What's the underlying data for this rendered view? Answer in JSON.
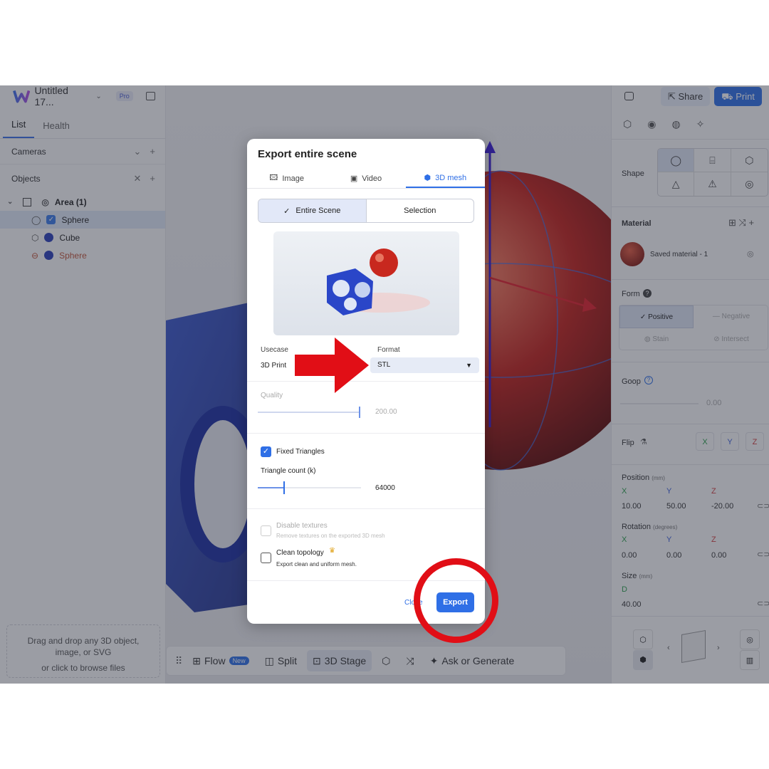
{
  "app": {
    "title": "Untitled 17...",
    "plan_badge": "Pro"
  },
  "left": {
    "tabs": [
      "List",
      "Health"
    ],
    "cameras_label": "Cameras",
    "objects_label": "Objects",
    "tree": [
      {
        "label": "Area (1)"
      },
      {
        "label": "Sphere"
      },
      {
        "label": "Cube"
      },
      {
        "label": "Sphere"
      }
    ],
    "drop_text_1": "Drag and drop any 3D object,",
    "drop_text_2": "image, or SVG",
    "drop_text_3_prefix": "or ",
    "drop_text_3_link": "click to browse files"
  },
  "right": {
    "share_label": "Share",
    "print_label": "Print",
    "shape_label": "Shape",
    "material_label": "Material",
    "material_name": "Saved material - 1",
    "form_label": "Form",
    "form_options": [
      "Positive",
      "Negative",
      "Stain",
      "Intersect"
    ],
    "goop_label": "Goop",
    "goop_value": "0.00",
    "flip_label": "Flip",
    "flip_axes": [
      "X",
      "Y",
      "Z"
    ],
    "position_label": "Position",
    "position_unit": "(mm)",
    "position": {
      "x": "10.00",
      "y": "50.00",
      "z": "-20.00"
    },
    "rotation_label": "Rotation",
    "rotation_unit": "(degrees)",
    "rotation": {
      "x": "0.00",
      "y": "0.00",
      "z": "0.00"
    },
    "size_label": "Size",
    "size_unit": "(mm)",
    "size_axis": "D",
    "size_value": "40.00",
    "axis_x": "X",
    "axis_y": "Y",
    "axis_z": "Z"
  },
  "toolbar": {
    "flow_label": "Flow",
    "new_badge": "New",
    "split_label": "Split",
    "stage_label": "3D Stage",
    "ask_label": "Ask or Generate"
  },
  "dialog": {
    "title": "Export entire scene",
    "tabs": [
      "Image",
      "Video",
      "3D mesh"
    ],
    "scope_options": [
      "Entire Scene",
      "Selection"
    ],
    "usecase_label": "Usecase",
    "usecase_value": "3D Print",
    "format_label": "Format",
    "format_value": "STL",
    "quality_label": "Quality",
    "quality_value": "200.00",
    "quality_fraction": 1.0,
    "fixed_triangles_label": "Fixed Triangles",
    "fixed_triangles_checked": true,
    "triangle_count_label": "Triangle count (k)",
    "triangle_count_value": "64000",
    "triangle_count_fraction": 0.25,
    "disable_textures_label": "Disable textures",
    "disable_textures_desc": "Remove textures on the exported 3D mesh",
    "clean_topology_label": "Clean topology",
    "clean_topology_desc": "Export clean and uniform mesh.",
    "close_label": "Close",
    "export_label": "Export"
  },
  "colors": {
    "accent": "#2f6fe6",
    "annotation_red": "#e10e16"
  }
}
